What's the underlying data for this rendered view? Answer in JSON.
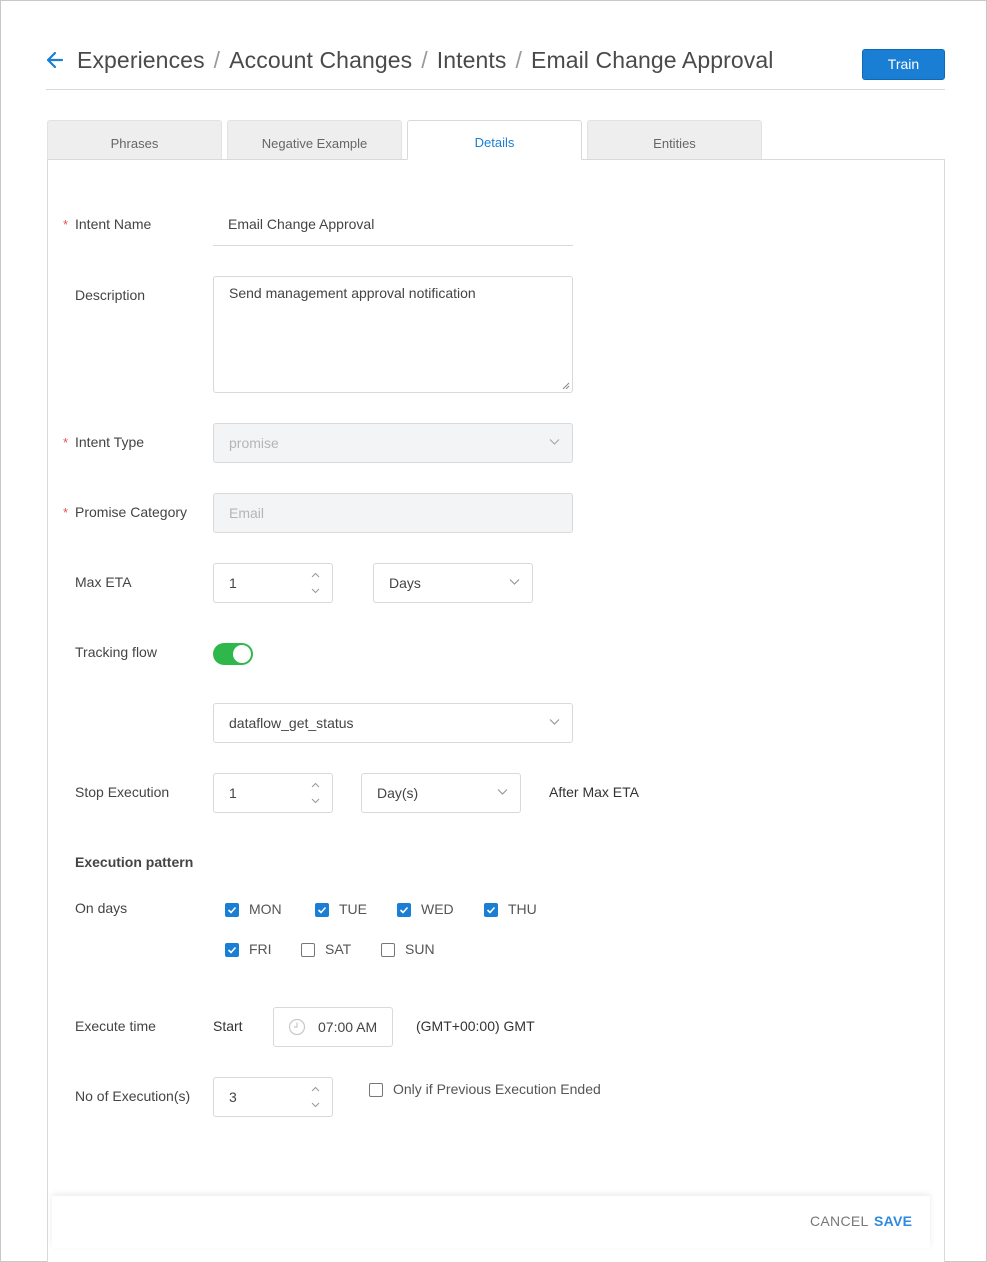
{
  "header": {
    "breadcrumb": [
      "Experiences",
      "Account Changes",
      "Intents",
      "Email Change Approval"
    ],
    "separator": "/",
    "train_label": "Train"
  },
  "tabs": [
    {
      "label": "Phrases",
      "active": false
    },
    {
      "label": "Negative Example",
      "active": false
    },
    {
      "label": "Details",
      "active": true
    },
    {
      "label": "Entities",
      "active": false
    }
  ],
  "form": {
    "required_mark": "*",
    "intent_name": {
      "label": "Intent Name",
      "value": "Email Change Approval"
    },
    "description": {
      "label": "Description",
      "value": "Send management approval notification"
    },
    "intent_type": {
      "label": "Intent Type",
      "value": "promise"
    },
    "promise_category": {
      "label": "Promise Category",
      "placeholder": "Email"
    },
    "max_eta": {
      "label": "Max ETA",
      "value": "1",
      "unit": "Days"
    },
    "tracking_flow": {
      "label": "Tracking flow",
      "enabled": true,
      "flow": "dataflow_get_status"
    },
    "stop_execution": {
      "label": "Stop Execution",
      "value": "1",
      "unit": "Day(s)",
      "suffix": "After Max ETA"
    },
    "execution_pattern": {
      "title": "Execution pattern",
      "on_days_label": "On days",
      "days": [
        {
          "label": "MON",
          "checked": true
        },
        {
          "label": "TUE",
          "checked": true
        },
        {
          "label": "WED",
          "checked": true
        },
        {
          "label": "THU",
          "checked": true
        },
        {
          "label": "FRI",
          "checked": true
        },
        {
          "label": "SAT",
          "checked": false
        },
        {
          "label": "SUN",
          "checked": false
        }
      ]
    },
    "execute_time": {
      "label": "Execute time",
      "start_label": "Start",
      "time": "07:00 AM",
      "timezone": "(GMT+00:00) GMT"
    },
    "executions": {
      "label": "No of Execution(s)",
      "value": "3",
      "only_if_previous_label": "Only if Previous Execution Ended",
      "only_if_previous_checked": false
    }
  },
  "footer": {
    "cancel_label": "CANCEL",
    "save_label": "SAVE"
  },
  "colors": {
    "accent": "#1a7fd4",
    "toggle_on": "#2eb84b",
    "required": "#e55353"
  }
}
